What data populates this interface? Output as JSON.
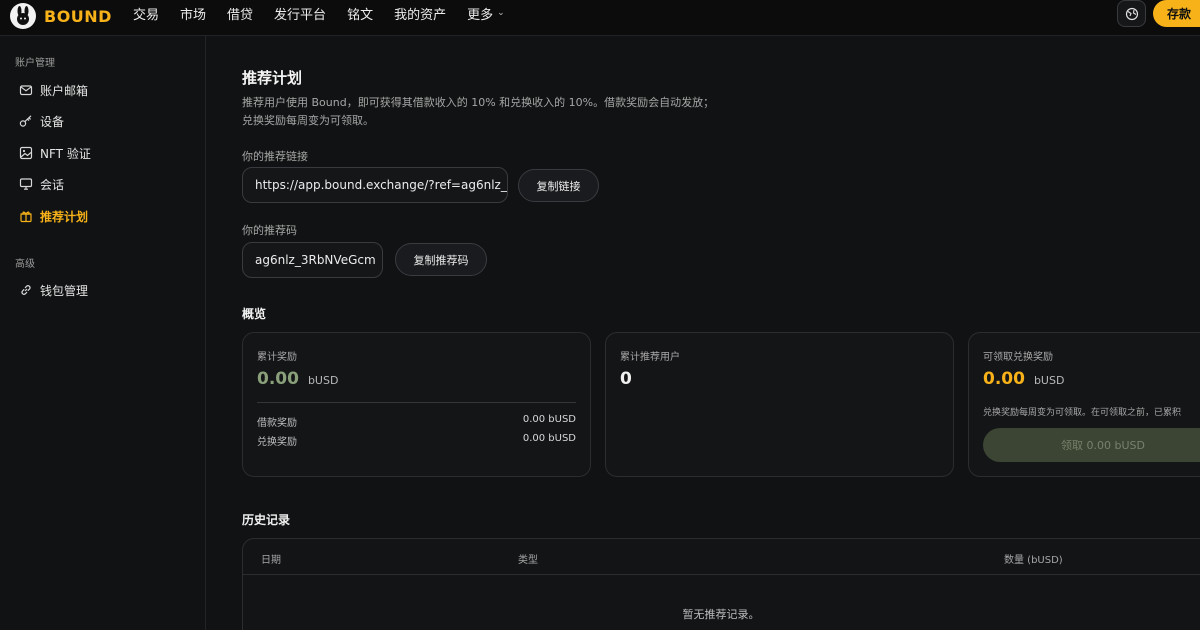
{
  "brand": {
    "name": "BOUND",
    "accent": "#f7b21a"
  },
  "nav": {
    "items": [
      "交易",
      "市场",
      "借贷",
      "发行平台",
      "铭文",
      "我的资产",
      "更多"
    ],
    "deposit_label": "存款"
  },
  "sidebar": {
    "section_account": "账户管理",
    "items": [
      {
        "label": "账户邮箱",
        "icon": "mail-icon"
      },
      {
        "label": "设备",
        "icon": "key-icon"
      },
      {
        "label": "NFT 验证",
        "icon": "image-icon"
      },
      {
        "label": "会话",
        "icon": "monitor-icon"
      },
      {
        "label": "推荐计划",
        "icon": "gift-icon",
        "active": true
      }
    ],
    "section_advanced": "高级",
    "advanced_items": [
      {
        "label": "钱包管理",
        "icon": "link-icon"
      }
    ]
  },
  "referral": {
    "title": "推荐计划",
    "description_line1": "推荐用户使用 Bound，即可获得其借款收入的 10% 和兑换收入的 10%。借款奖励会自动发放；",
    "description_line2": "兑换奖励每周变为可领取。",
    "link_label": "你的推荐链接",
    "link_value": "https://app.bound.exchange/?ref=ag6nlz_",
    "copy_link_label": "复制链接",
    "code_label": "你的推荐码",
    "code_value": "ag6nlz_3RbNVeGcm",
    "copy_code_label": "复制推荐码"
  },
  "overview": {
    "title": "概览",
    "total_rewards": {
      "label": "累计奖励",
      "value": "0.00",
      "unit": "bUSD",
      "value_color": "#8aa07a",
      "borrow_label": "借款奖励",
      "borrow_value": "0.00 bUSD",
      "swap_label": "兑换奖励",
      "swap_value": "0.00 bUSD"
    },
    "referred_users": {
      "label": "累计推荐用户",
      "value": "0"
    },
    "claimable": {
      "label": "可领取兑换奖励",
      "value": "0.00",
      "unit": "bUSD",
      "value_color": "#f7b21a",
      "note": "兑换奖励每周变为可领取。在可领取之前，已累积",
      "claim_label": "领取 0.00 bUSD"
    }
  },
  "history": {
    "title": "历史记录",
    "columns": [
      "日期",
      "类型",
      "数量 (bUSD)"
    ],
    "empty_text": "暂无推荐记录。"
  }
}
